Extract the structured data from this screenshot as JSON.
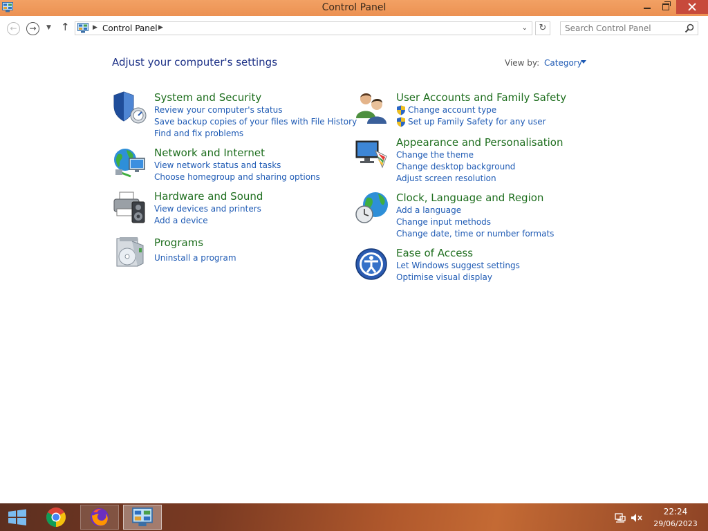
{
  "window": {
    "title": "Control Panel"
  },
  "address_bar": {
    "path": "Control Panel"
  },
  "search": {
    "placeholder": "Search Control Panel"
  },
  "header": {
    "title": "Adjust your computer's settings",
    "view_by_label": "View by:",
    "view_by_value": "Category"
  },
  "categories": [
    {
      "title": "System and Security",
      "icon": "shield-icon",
      "links": [
        "Review your computer's status",
        "Save backup copies of your files with File History",
        "Find and fix problems"
      ]
    },
    {
      "title": "Network and Internet",
      "icon": "network-globe-icon",
      "links": [
        "View network status and tasks",
        "Choose homegroup and sharing options"
      ]
    },
    {
      "title": "Hardware and Sound",
      "icon": "printer-speaker-icon",
      "links": [
        "View devices and printers",
        "Add a device"
      ]
    },
    {
      "title": "Programs",
      "icon": "programs-disc-icon",
      "links": [
        "Uninstall a program"
      ]
    },
    {
      "title": "User Accounts and Family Safety",
      "icon": "users-icon",
      "links": [
        "Change account type",
        "Set up Family Safety for any user"
      ]
    },
    {
      "title": "Appearance and Personalisation",
      "icon": "monitor-palette-icon",
      "links": [
        "Change the theme",
        "Change desktop background",
        "Adjust screen resolution"
      ]
    },
    {
      "title": "Clock, Language and Region",
      "icon": "clock-globe-icon",
      "links": [
        "Add a language",
        "Change input methods",
        "Change date, time or number formats"
      ]
    },
    {
      "title": "Ease of Access",
      "icon": "ease-of-access-icon",
      "links": [
        "Let Windows suggest settings",
        "Optimise visual display"
      ]
    }
  ],
  "taskbar": {
    "time": "22:24",
    "date": "29/06/2023"
  },
  "colors": {
    "title_bar": "#ec9152",
    "category_title": "#1e6e1e",
    "link": "#1e5ab4",
    "heading": "#1e3287"
  }
}
